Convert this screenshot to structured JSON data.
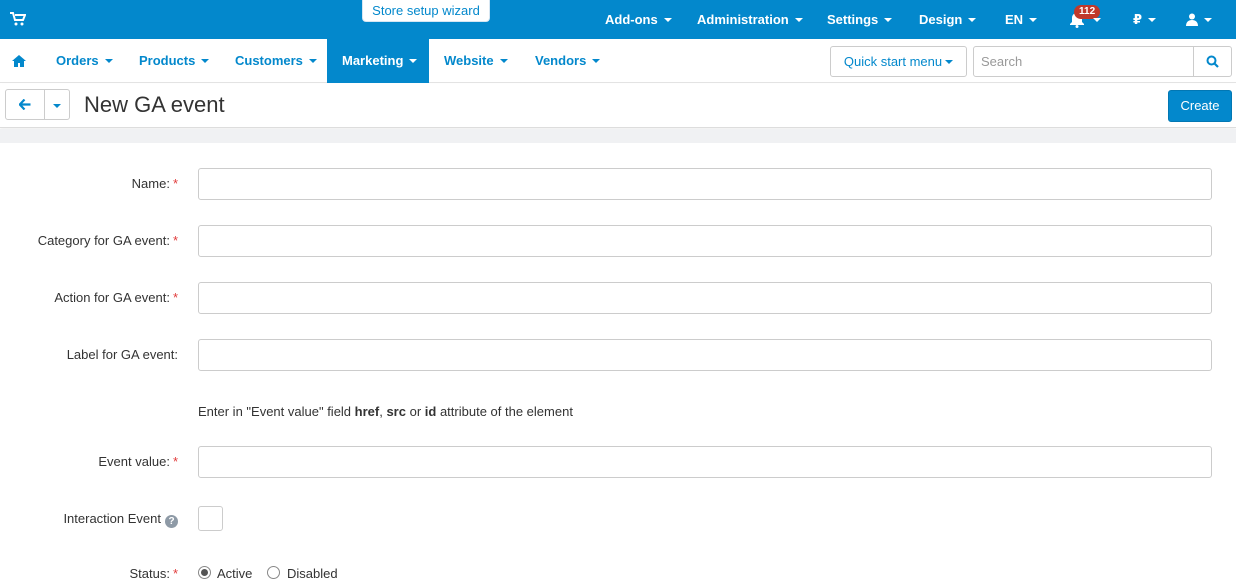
{
  "topbar": {
    "wizard": "Store setup wizard",
    "menus": [
      "Add-ons",
      "Administration",
      "Settings",
      "Design",
      "EN"
    ],
    "notifications_count": "112",
    "currency": "₽"
  },
  "nav": {
    "items": [
      "Orders",
      "Products",
      "Customers",
      "Marketing",
      "Website",
      "Vendors"
    ],
    "active": "Marketing",
    "quick_start": "Quick start menu",
    "search_placeholder": "Search"
  },
  "header": {
    "title": "New GA event",
    "create_label": "Create"
  },
  "form": {
    "name_label": "Name:",
    "category_label": "Category for GA event:",
    "action_label": "Action for GA event:",
    "label_label": "Label for GA event:",
    "hint": {
      "pre": "Enter in \"Event value\" field ",
      "href": "href",
      "comma": ", ",
      "src": "src",
      "or": " or ",
      "id": "id",
      "post": " attribute of the element"
    },
    "event_value_label": "Event value:",
    "interaction_label": "Interaction Event",
    "status_label": "Status:",
    "status_options": [
      "Active",
      "Disabled"
    ],
    "status_selected": "Active",
    "required_mark": "*",
    "help_mark": "?"
  },
  "colors": {
    "primary": "#0388cc",
    "required": "#e13b3b",
    "badge": "#c0392b"
  }
}
